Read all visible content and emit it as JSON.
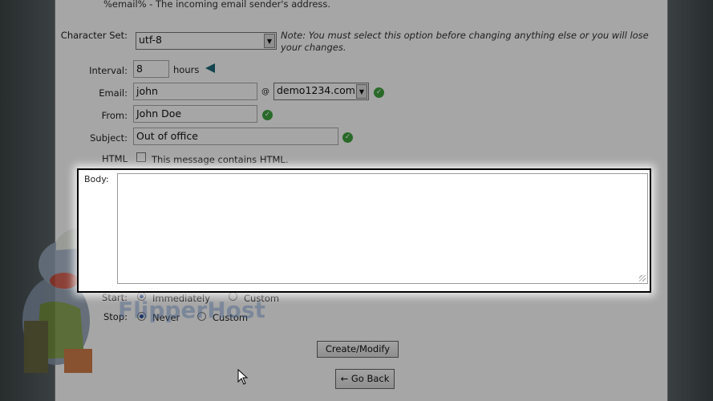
{
  "header_line": "%email% -  The incoming email sender's address.",
  "form": {
    "charset": {
      "label": "Character Set:",
      "value": "utf-8",
      "note": "Note: You must select this option before changing anything else or you will lose your changes."
    },
    "interval": {
      "label": "Interval:",
      "value": "8",
      "unit": "hours"
    },
    "email": {
      "label": "Email:",
      "user": "john",
      "at": "@",
      "domain": "demo1234.com"
    },
    "from": {
      "label": "From:",
      "value": "John Doe"
    },
    "subject": {
      "label": "Subject:",
      "value": "Out of office"
    },
    "html": {
      "label": "HTML",
      "checkbox_label": "This message contains HTML."
    },
    "body": {
      "label": "Body:",
      "value": ""
    },
    "start": {
      "label": "Start:",
      "opt1": "Immediately",
      "opt2": "Custom"
    },
    "stop": {
      "label": "Stop:",
      "opt1": "Never",
      "opt2": "Custom"
    }
  },
  "buttons": {
    "create": "Create/Modify",
    "back": "← Go Back"
  },
  "watermark": "FlipperHost",
  "colors": {
    "check": "#3fa33f",
    "panel_bg": "#ffffff",
    "side_bg": "#4a5456"
  }
}
